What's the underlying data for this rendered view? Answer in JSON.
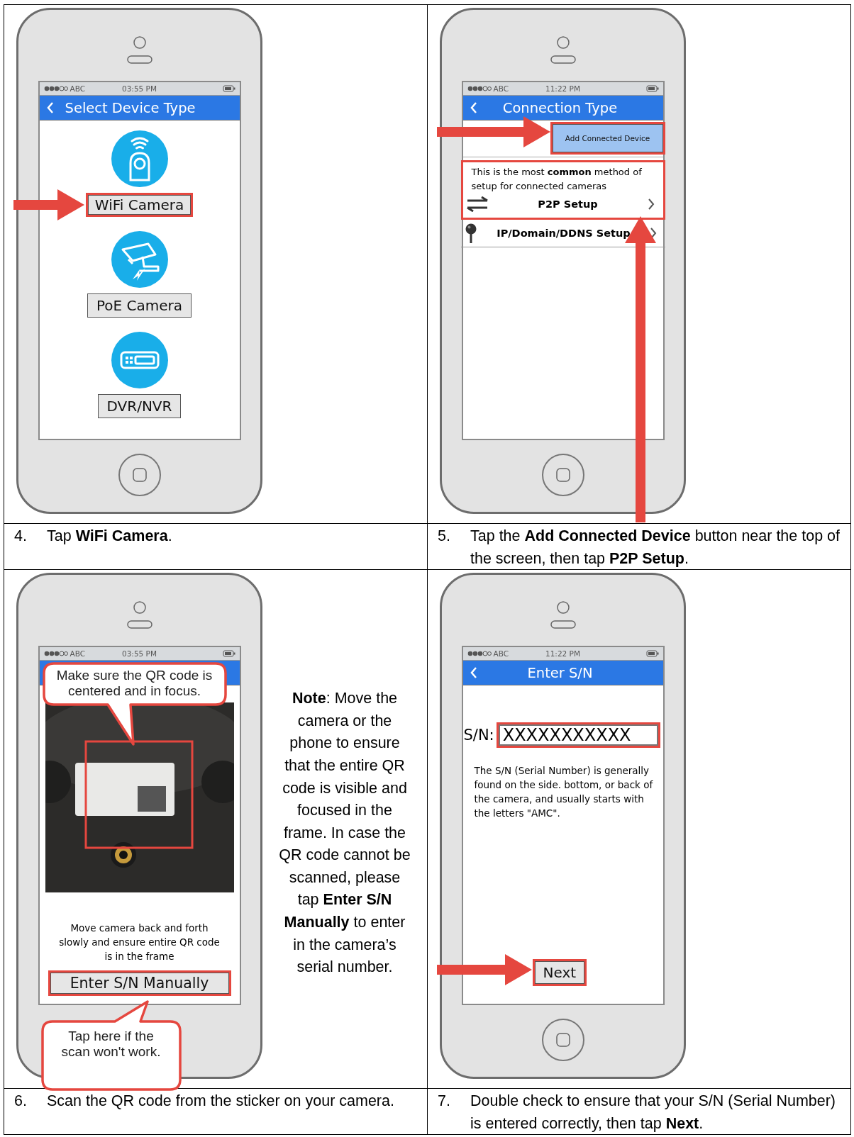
{
  "steps": [
    {
      "number": "4.",
      "caption": "Tap **WiFi Camera**.",
      "screen": {
        "kind": "device_type",
        "carrier": "ABC",
        "time": "03:55 PM",
        "title": "Select Device Type",
        "options": [
          {
            "label": "WiFi Camera",
            "highlighted": true
          },
          {
            "label": "PoE Camera",
            "highlighted": false
          },
          {
            "label": "DVR/NVR",
            "highlighted": false
          }
        ]
      }
    },
    {
      "number": "5.",
      "caption": "Tap the **Add Connected Device** button near the top of the screen, then tap **P2P Setup**.",
      "screen": {
        "kind": "connection_type",
        "carrier": "ABC",
        "time": "11:22 PM",
        "title": "Connection Type",
        "add_button": {
          "label": "Add Connected Device",
          "highlighted": true
        },
        "items": [
          {
            "description": "This is the most **common** method of setup for connected cameras",
            "label": "P2P Setup",
            "highlighted": true
          },
          {
            "label": "IP/Domain/DDNS Setup",
            "highlighted": false
          }
        ]
      }
    },
    {
      "number": "6.",
      "caption": "Scan the QR code from the sticker on your camera.",
      "screen": {
        "kind": "scan",
        "carrier": "ABC",
        "time": "03:55 PM",
        "callout_top": "Make sure the QR code is centered and in focus.",
        "hint": "Move camera back and forth slowly and ensure entire QR code is in the frame",
        "button": "Enter S/N Manually",
        "callout_bottom": "Tap here if the scan won't work."
      },
      "note": "**Note**: Move the camera or the phone to ensure that the entire QR code is visible and focused in the frame. In case the QR code cannot be scanned, please tap **Enter S/N Manually** to enter in the camera’s serial number."
    },
    {
      "number": "7.",
      "caption": "Double check to ensure that your S/N (Serial Number) is entered correctly, then tap **Next**.",
      "screen": {
        "kind": "enter_sn",
        "carrier": "ABC",
        "time": "11:22 PM",
        "title": "Enter S/N",
        "field_label": "S/N:",
        "field_value": "XXXXXXXXXXX",
        "info": "The S/N (Serial Number) is generally found on the side. bottom, or back of the camera, and usually starts with the letters \"AMC\".",
        "button": "Next"
      }
    }
  ]
}
